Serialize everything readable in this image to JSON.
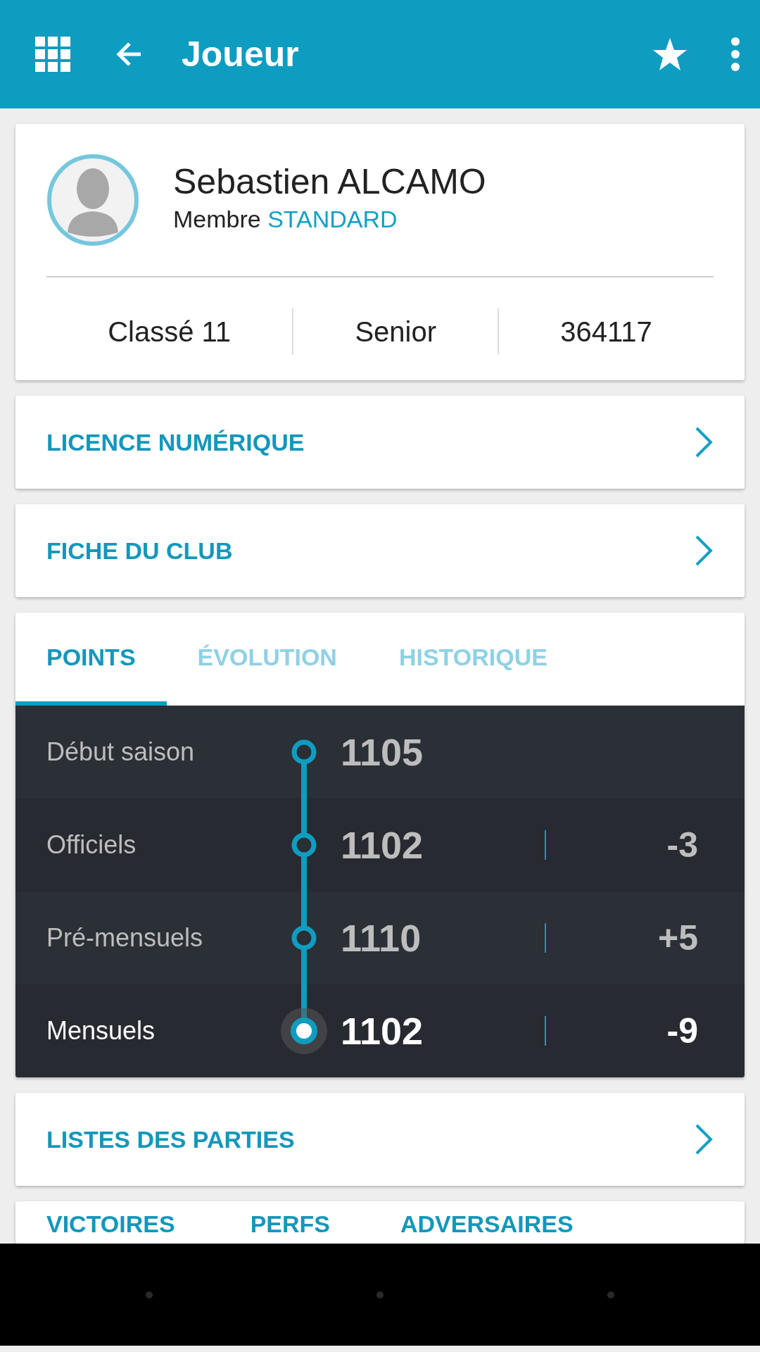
{
  "app_bar": {
    "title": "Joueur"
  },
  "profile": {
    "name": "Sebastien ALCAMO",
    "membership_label": "Membre",
    "membership_level": "STANDARD",
    "stats": [
      "Classé 11",
      "Senior",
      "364117"
    ]
  },
  "links_top": [
    {
      "label": "LICENCE NUMÉRIQUE"
    },
    {
      "label": "FICHE DU CLUB"
    }
  ],
  "points_tabs": [
    {
      "label": "POINTS",
      "selected": true
    },
    {
      "label": "ÉVOLUTION",
      "selected": false
    },
    {
      "label": "HISTORIQUE",
      "selected": false
    }
  ],
  "points_rows": [
    {
      "label": "Début saison",
      "value": "1105",
      "current": false
    },
    {
      "label": "Officiels",
      "value": "1102",
      "delta": "-3",
      "current": false
    },
    {
      "label": "Pré-mensuels",
      "value": "1110",
      "delta": "+5",
      "current": false
    },
    {
      "label": "Mensuels",
      "value": "1102",
      "delta": "-9",
      "current": true
    }
  ],
  "links_bottom": [
    {
      "label": "LISTES DES PARTIES"
    }
  ],
  "stats_tabs": [
    {
      "label": "VICTOIRES"
    },
    {
      "label": "PERFS"
    },
    {
      "label": "ADVERSAIRES"
    }
  ]
}
